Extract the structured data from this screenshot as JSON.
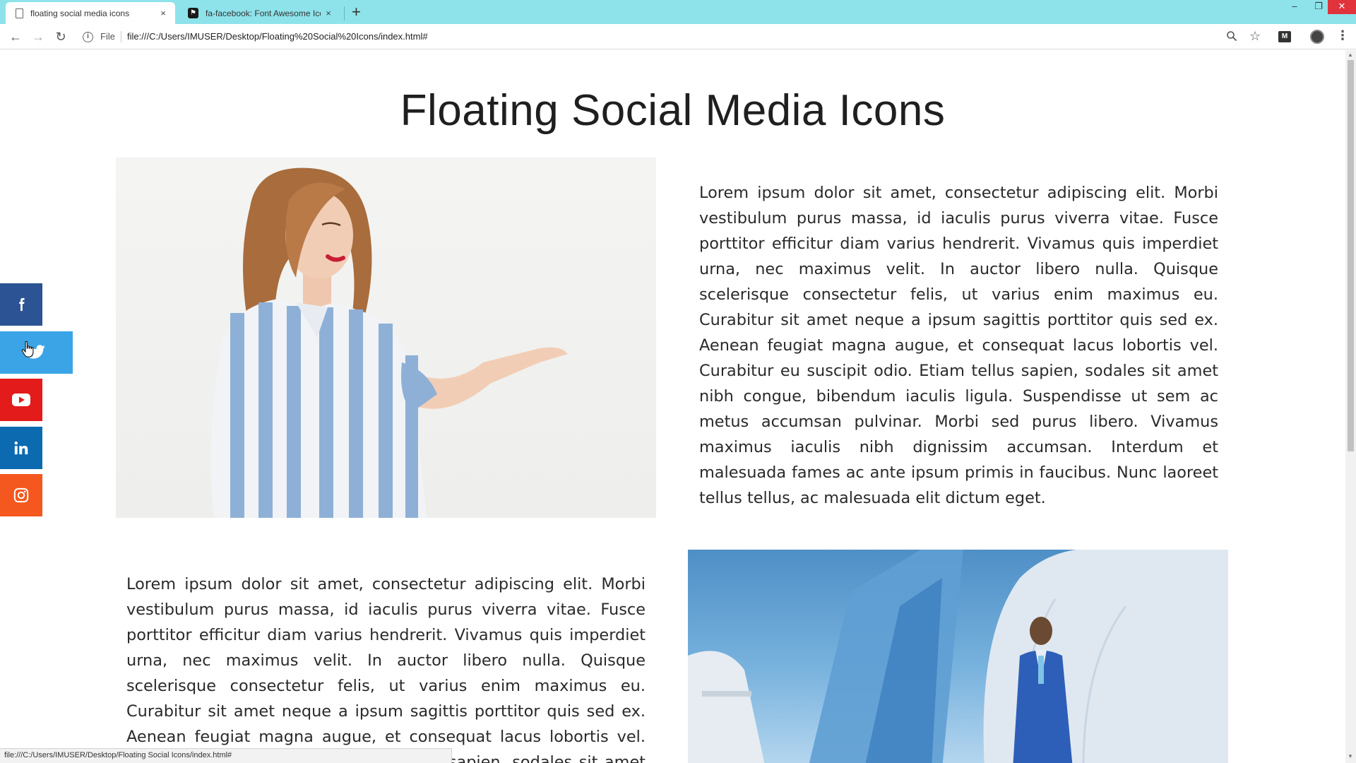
{
  "browser": {
    "tabs": [
      {
        "title": "floating social media icons",
        "close": "×"
      },
      {
        "title": "fa-facebook: Font Awesome Icon",
        "close": "×"
      }
    ],
    "new_tab": "+",
    "window": {
      "minimize": "–",
      "maximize": "❐",
      "close": "✕"
    },
    "address": {
      "scheme_label": "File",
      "url": "file:///C:/Users/IMUSER/Desktop/Floating%20Social%20Icons/index.html#"
    },
    "status_url": "file:///C:/Users/IMUSER/Desktop/Floating Social Icons/index.html#",
    "extension_badge": "M"
  },
  "page": {
    "title": "Floating Social Media Icons",
    "paragraph_1": "Lorem ipsum dolor sit amet, consectetur adipiscing elit. Morbi vestibulum purus massa, id iaculis purus viverra vitae. Fusce porttitor efficitur diam varius hendrerit. Vivamus quis imperdiet urna, nec maximus velit. In auctor libero nulla. Quisque scelerisque consectetur felis, ut varius enim maximus eu. Curabitur sit amet neque a ipsum sagittis porttitor quis sed ex. Aenean feugiat magna augue, et consequat lacus lobortis vel. Curabitur eu suscipit odio. Etiam tellus sapien, sodales sit amet nibh congue, bibendum iaculis ligula. Suspendisse ut sem ac metus accumsan pulvinar. Morbi sed purus libero. Vivamus maximus iaculis nibh dignissim accumsan. Interdum et malesuada fames ac ante ipsum primis in faucibus. Nunc laoreet tellus tellus, ac malesuada elit dictum eget.",
    "paragraph_2": "Lorem ipsum dolor sit amet, consectetur adipiscing elit. Morbi vestibulum purus massa, id iaculis purus viverra vitae. Fusce porttitor efficitur diam varius hendrerit. Vivamus quis imperdiet urna, nec maximus velit. In auctor libero nulla. Quisque scelerisque consectetur felis, ut varius enim maximus eu. Curabitur sit amet neque a ipsum sagittis porttitor quis sed ex. Aenean feugiat magna augue, et consequat lacus lobortis vel. Curabitur eu suscipit odio. Etiam tellus sapien, sodales sit amet nibh congue, bibendum iaculis ligula."
  },
  "social": [
    {
      "name": "facebook",
      "icon": "facebook-icon",
      "color": "#2c5394"
    },
    {
      "name": "twitter",
      "icon": "twitter-icon",
      "color": "#3aa4e6",
      "state": "hovered"
    },
    {
      "name": "youtube",
      "icon": "youtube-icon",
      "color": "#e31b1b"
    },
    {
      "name": "linkedin",
      "icon": "linkedin-icon",
      "color": "#0b6ab0"
    },
    {
      "name": "instagram",
      "icon": "instagram-icon",
      "color": "#f4581f"
    }
  ]
}
